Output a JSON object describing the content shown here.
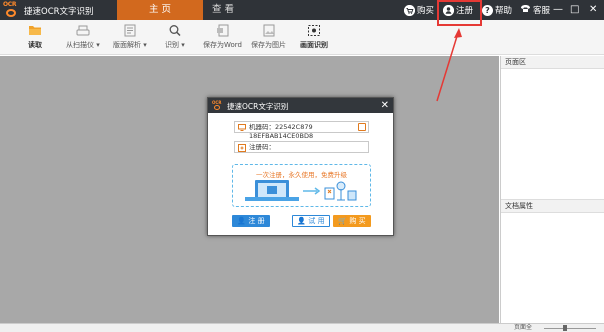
{
  "app": {
    "title": "捷速OCR文字识别",
    "logo_text": "OCR"
  },
  "tabs": [
    {
      "label": "主 页"
    },
    {
      "label": "查 看"
    }
  ],
  "top_actions": {
    "buy": "购买",
    "register": "注册",
    "help": "帮助",
    "service": "客服"
  },
  "window_controls": {
    "minimize": "—",
    "maximize": "□",
    "close": "✕"
  },
  "toolbar": {
    "read": "读取",
    "from_scanner": "从扫描仪",
    "layout_analysis": "版面解析",
    "recognize": "识别",
    "save_word": "保存为Word",
    "save_image": "保存为图片",
    "region_recognize": "画面识别"
  },
  "right_panel": {
    "pages_title": "页面区",
    "doc_props_title": "文档属性"
  },
  "statusbar": {
    "zoom_label": "页面全"
  },
  "dialog": {
    "title": "捷速OCR文字识别",
    "close": "✕",
    "machine_code_label": "机器码：22542C879​18EFBAB14CE0BD8",
    "reg_code_label": "注册码：",
    "slogan": "一次注册，永久使用，免费升级",
    "register_button": "注 册",
    "try_button": "试 用",
    "buy_button": "购 买"
  },
  "colors": {
    "titlebar": "#2f3338",
    "active_tab": "#d2691e",
    "accent_orange": "#f39a1e",
    "accent_blue": "#2d88d8",
    "annotation_red": "#e53935"
  }
}
